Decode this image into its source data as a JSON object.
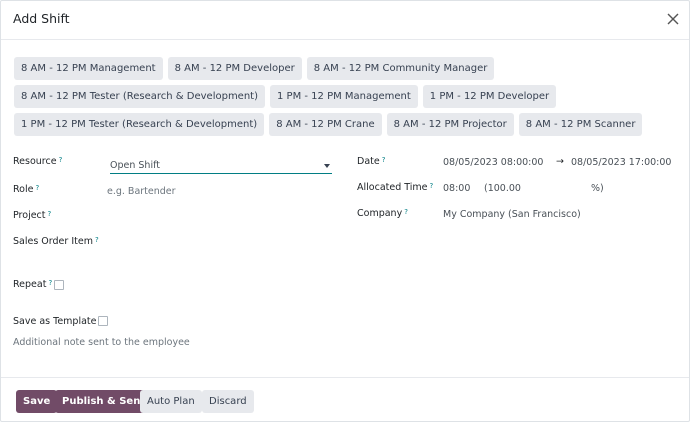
{
  "dialog": {
    "title": "Add Shift"
  },
  "templates": {
    "row1": [
      "8 AM - 12 PM Management",
      "8 AM - 12 PM Developer",
      "8 AM - 12 PM Community Manager"
    ],
    "row2": [
      "8 AM - 12 PM Tester (Research & Development)",
      "1 PM - 12 PM Management",
      "1 PM - 12 PM Developer"
    ],
    "row3": [
      "1 PM - 12 PM Tester (Research & Development)",
      "8 AM - 12 PM Crane",
      "8 AM - 12 PM Projector",
      "8 AM - 12 PM Scanner"
    ]
  },
  "form": {
    "resource": {
      "label": "Resource",
      "value": "Open Shift"
    },
    "role": {
      "label": "Role",
      "placeholder": "e.g. Bartender"
    },
    "project": {
      "label": "Project"
    },
    "sales_order_item": {
      "label": "Sales Order Item"
    },
    "repeat": {
      "label": "Repeat"
    },
    "save_template": {
      "label": "Save as Template"
    },
    "note_placeholder": "Additional note sent to the employee",
    "date": {
      "label": "Date",
      "start": "08/05/2023 08:00:00",
      "end": "08/05/2023 17:00:00"
    },
    "allocated_time": {
      "label": "Allocated Time",
      "hours": "08:00",
      "percent_open": "(100.00",
      "percent_close": "%)"
    },
    "company": {
      "label": "Company",
      "value": "My Company (San Francisco)"
    },
    "help_marker": "?",
    "arrow": "→"
  },
  "footer": {
    "save": "Save",
    "publish": "Publish & Send",
    "auto_plan": "Auto Plan",
    "discard": "Discard"
  },
  "colors": {
    "primary": "#714b67",
    "accent": "#017e84"
  },
  "icons": {
    "close": "close-icon",
    "dropdown": "chevron-down-icon"
  }
}
